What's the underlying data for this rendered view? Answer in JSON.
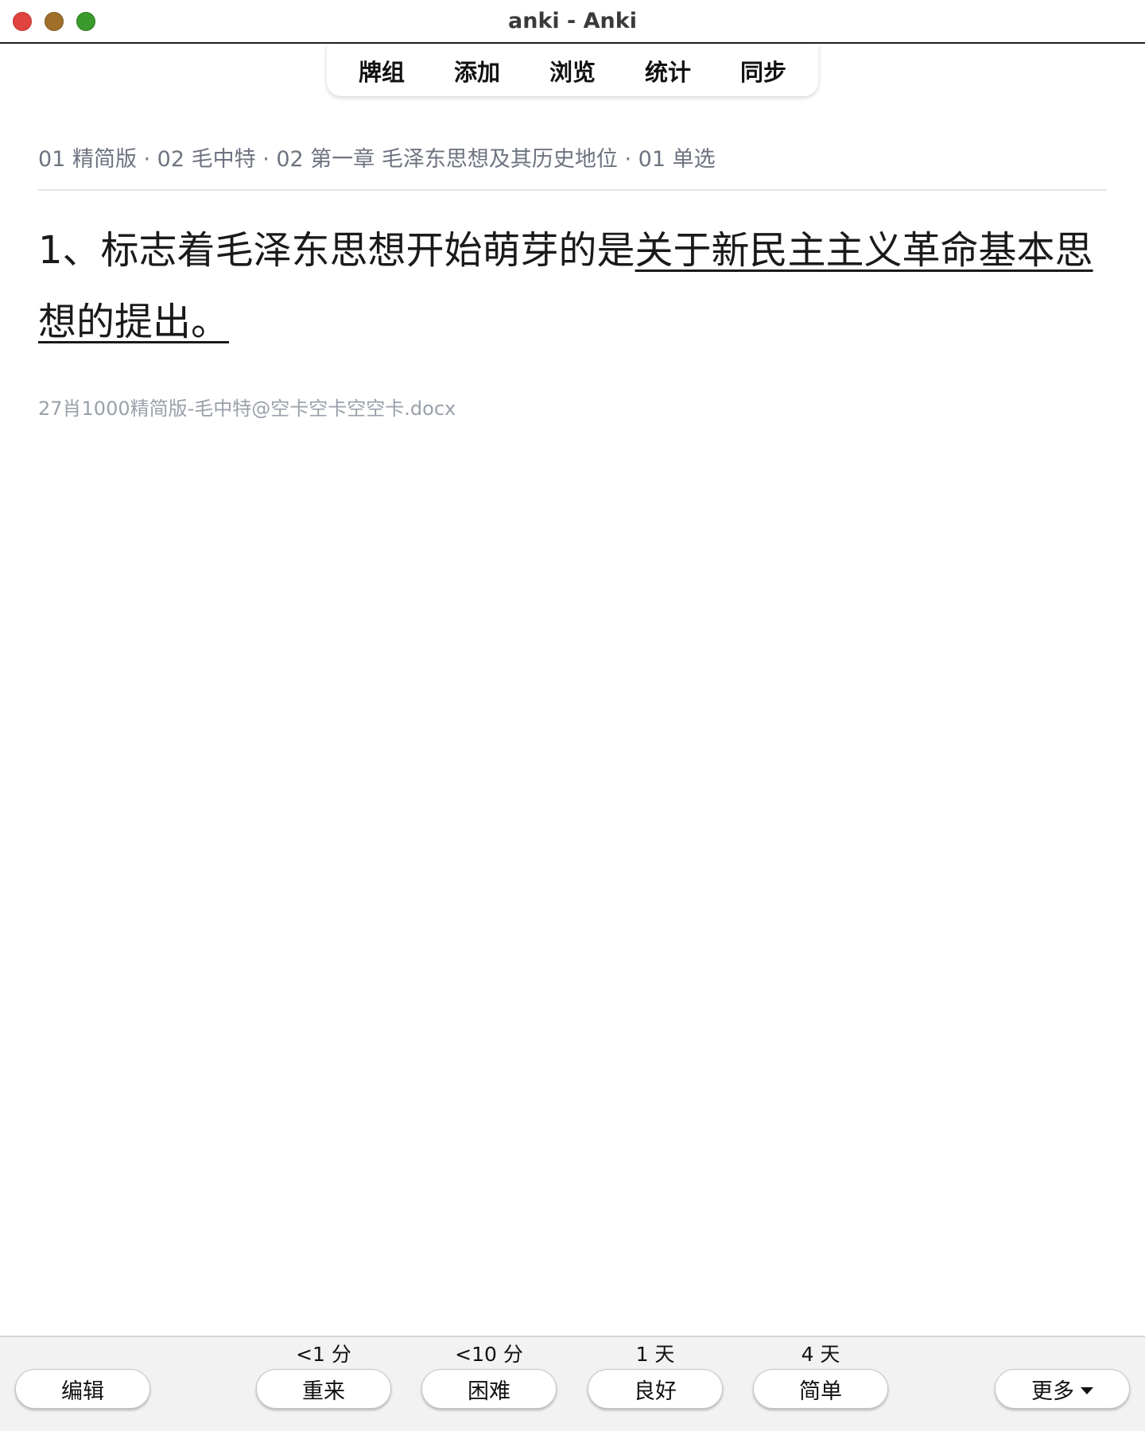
{
  "window": {
    "title": "anki - Anki"
  },
  "nav": {
    "items": [
      "牌组",
      "添加",
      "浏览",
      "统计",
      "同步"
    ]
  },
  "card": {
    "breadcrumb": "01 精简版 · 02 毛中特 · 02 第一章 毛泽东思想及其历史地位 · 01 单选",
    "question_prefix": "1、标志着毛泽东思想开始萌芽的是",
    "question_answer": "关于新民主主义革命基本思想的提出。",
    "source": "27肖1000精简版-毛中特@空卡空卡空空卡.docx"
  },
  "bottom": {
    "edit_label": "编辑",
    "more_label": "更多",
    "answers": [
      {
        "interval": "<1 分",
        "label": "重来"
      },
      {
        "interval": "<10 分",
        "label": "困难"
      },
      {
        "interval": "1 天",
        "label": "良好"
      },
      {
        "interval": "4 天",
        "label": "简单"
      }
    ]
  }
}
